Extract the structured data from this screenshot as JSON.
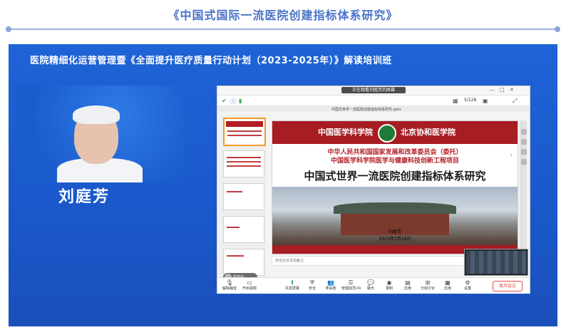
{
  "header": {
    "title": "《中国式国际一流医院创建指标体系研究》"
  },
  "banner": {
    "text": "医院精细化运营管理暨《全面提升医疗质量行动计划（2023-2025年）》解读培训班"
  },
  "speaker": {
    "name": "刘庭芳"
  },
  "window": {
    "title": "正在观看刘庭芳的屏幕",
    "page_indicator": "5/128",
    "doc_tab": "中国式世界一流医院创建指标体系研究.pptx"
  },
  "slide": {
    "logo_left": "中国医学科学院",
    "logo_right": "北京协和医学院",
    "subtitle1": "中华人民共和国国家发展和改革委员会（委托）",
    "subtitle2": "中国医学科学院医学与健康科技创新工程项目",
    "title": "中国式世界一流医院创建指标体系研究",
    "speaker_line": "刘庭芳",
    "date": "2023年7月18日"
  },
  "share_chip": {
    "label": "共享中..."
  },
  "notes": {
    "placeholder": "单击此处添加备注"
  },
  "zoombar": {
    "items": [
      {
        "label": "解除静音",
        "icon": "mic-icon"
      },
      {
        "label": "开启视频",
        "icon": "camera-icon"
      },
      {
        "label": "共享屏幕",
        "icon": "share-icon"
      },
      {
        "label": "安全",
        "icon": "shield-icon"
      },
      {
        "label": "参会者",
        "icon": "participants-icon"
      },
      {
        "label": "管理成员(4)",
        "icon": "manage-icon"
      },
      {
        "label": "聊天",
        "icon": "chat-icon"
      },
      {
        "label": "录制",
        "icon": "record-icon"
      },
      {
        "label": "应用",
        "icon": "apps-icon"
      },
      {
        "label": "分组讨论",
        "icon": "breakout-icon"
      },
      {
        "label": "应用",
        "icon": "apps2-icon"
      },
      {
        "label": "设置",
        "icon": "gear-icon"
      }
    ],
    "end_label": "离开会议"
  },
  "colors": {
    "accent": "#4a72c8",
    "stage_blue": "#1f63d6",
    "slide_red": "#a61d22",
    "end_red": "#e14a4a"
  }
}
